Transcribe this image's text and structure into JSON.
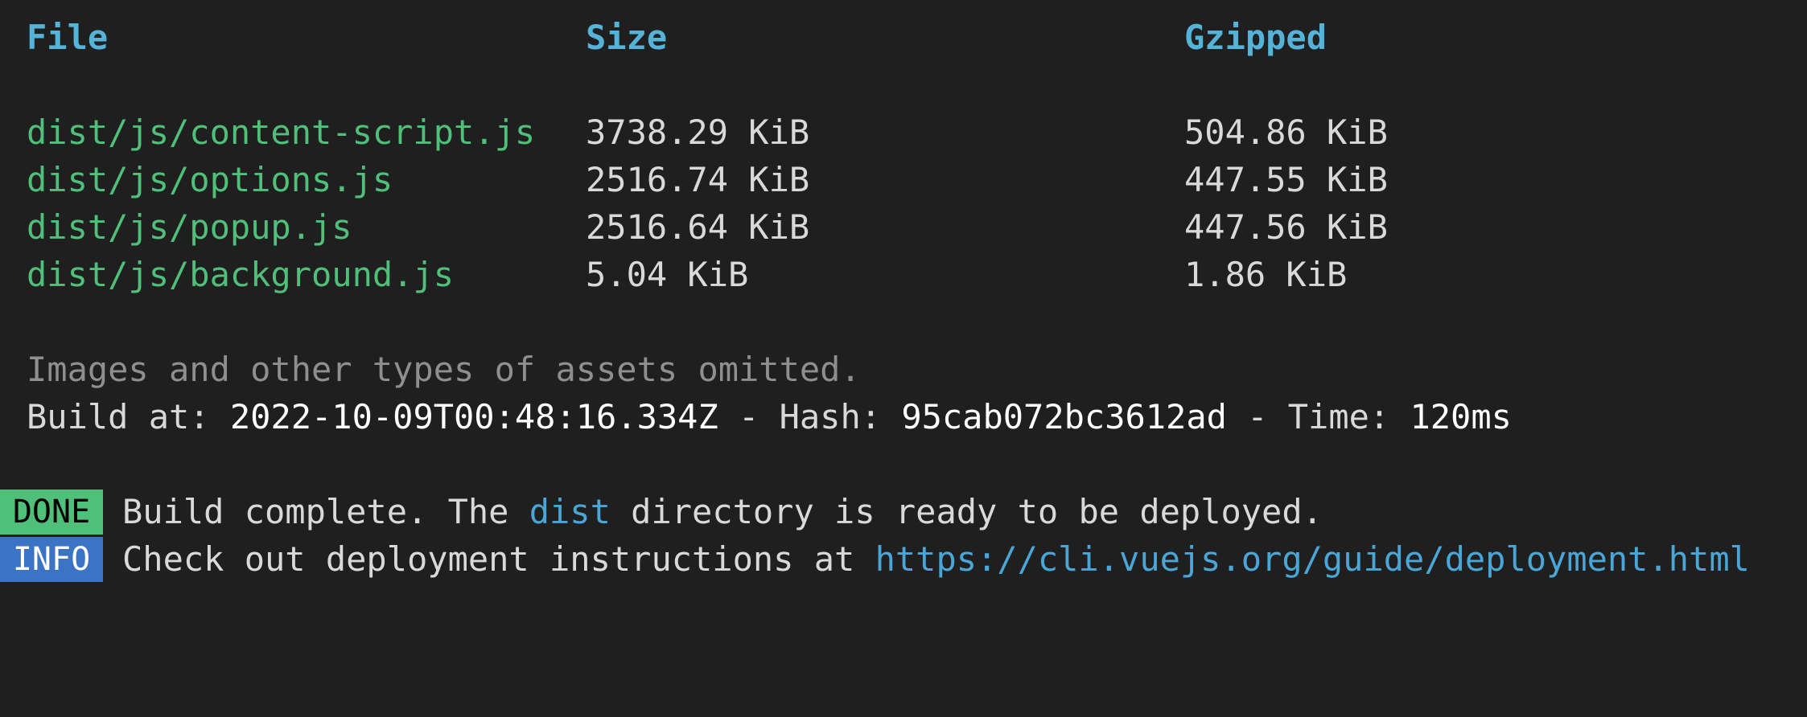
{
  "colors": {
    "background": "#1f1f1f",
    "header": "#55b3d8",
    "file": "#4fbf79",
    "text": "#d9d9d9",
    "muted": "#8f8f8f",
    "link": "#4aa6d6",
    "done_badge": "#4fbf79",
    "info_badge": "#3b73c5"
  },
  "table": {
    "headers": [
      "File",
      "Size",
      "Gzipped"
    ],
    "rows": [
      {
        "file": "dist/js/content-script.js",
        "size": "3738.29 KiB",
        "gzipped": "504.86 KiB"
      },
      {
        "file": "dist/js/options.js",
        "size": "2516.74 KiB",
        "gzipped": "447.55 KiB"
      },
      {
        "file": "dist/js/popup.js",
        "size": "2516.64 KiB",
        "gzipped": "447.56 KiB"
      },
      {
        "file": "dist/js/background.js",
        "size": "5.04 KiB",
        "gzipped": "1.86 KiB"
      }
    ]
  },
  "omitted_note": "Images and other types of assets omitted.",
  "build_line": {
    "prefix": "Build at: ",
    "timestamp": "2022-10-09T00:48:16.334Z",
    "hash_sep": " - Hash: ",
    "hash": "95cab072bc3612ad",
    "time_sep": " - Time: ",
    "time": "120ms"
  },
  "done": {
    "badge": "DONE",
    "text_before": "Build complete. The ",
    "dist_word": "dist",
    "text_after": " directory is ready to be deployed."
  },
  "info": {
    "badge": "INFO",
    "text": "Check out deployment instructions at ",
    "url": "https://cli.vuejs.org/guide/deployment.html"
  }
}
